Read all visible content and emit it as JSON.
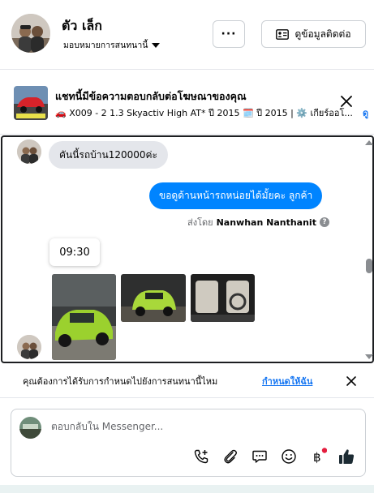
{
  "header": {
    "contact_name": "ตัว เล็ก",
    "assign_label": "มอบหมายการสนทนานี้",
    "more_label": "···",
    "contact_info_label": "ดูข้อมูลติดต่อ"
  },
  "ad_banner": {
    "title": "แชทนี้มีข้อความตอบกลับต่อโฆษณาของคุณ",
    "subtitle": "🚗 X009 - 2 1.3 Skyactiv High AT* ปี 2015 🗓️ ปี 2015 | ⚙️ เกียร์ออโ...",
    "link_label": "ดู"
  },
  "messages": {
    "incoming_text": "คันนี้รถบ้าน120000ค่ะ",
    "outgoing_text": "ขอดูด้านหน้ารถหน่อยได้มั้ยคะ  ลูกค้า",
    "sent_by_prefix": "ส่งโดย",
    "sent_by_name": "Nanwhan Nanthanit",
    "timestamp": "09:30"
  },
  "reminder": {
    "text": "คุณต้องการได้รับการกำหนดไปยังการสนทนานี้ไหม",
    "link_label": "กำหนดให้ฉัน"
  },
  "composer": {
    "placeholder": "ตอบกลับใน Messenger..."
  },
  "colors": {
    "accent": "#1877f2",
    "outgoing_bubble": "#0084ff",
    "incoming_bubble": "#e4e6eb",
    "notification_dot": "#e41e3f"
  }
}
